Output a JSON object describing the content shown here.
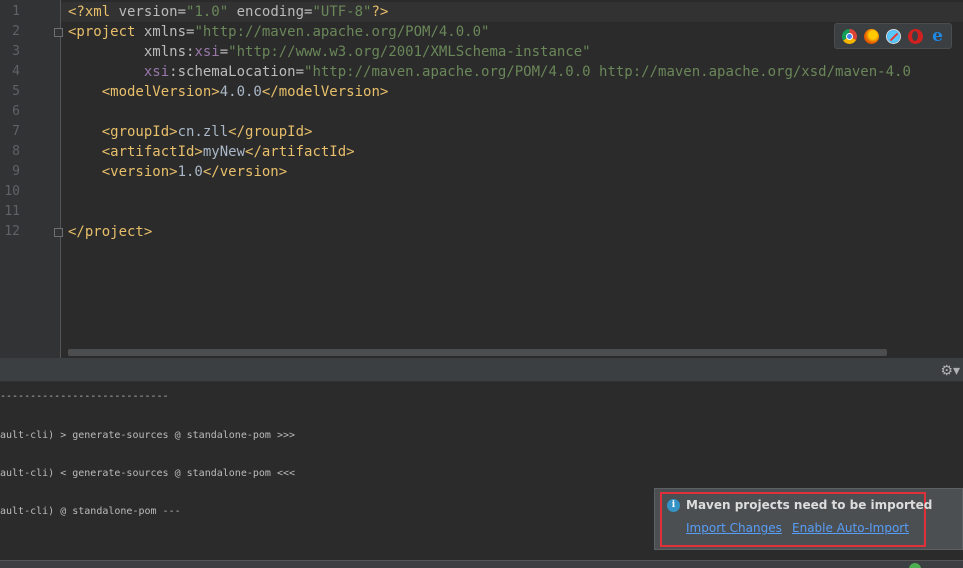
{
  "editor": {
    "line_numbers": [
      "1",
      "2",
      "3",
      "4",
      "5",
      "6",
      "7",
      "8",
      "9",
      "10",
      "11",
      "12"
    ],
    "lines": [
      [
        {
          "t": "<?xml ",
          "c": "t-pi"
        },
        {
          "t": "version=",
          "c": "t-attr"
        },
        {
          "t": "\"1.0\"",
          "c": "t-str"
        },
        {
          "t": " encoding=",
          "c": "t-attr"
        },
        {
          "t": "\"UTF-8\"",
          "c": "t-str"
        },
        {
          "t": "?>",
          "c": "t-pi"
        }
      ],
      [
        {
          "t": "<project ",
          "c": "t-tag"
        },
        {
          "t": "xmlns=",
          "c": "t-attr"
        },
        {
          "t": "\"http://maven.apache.org/POM/4.0.0\"",
          "c": "t-str"
        }
      ],
      [
        {
          "t": "         xmlns:",
          "c": "t-attr"
        },
        {
          "t": "xsi",
          "c": "t-ns"
        },
        {
          "t": "=",
          "c": "t-attr"
        },
        {
          "t": "\"http://www.w3.org/2001/XMLSchema-instance\"",
          "c": "t-str"
        }
      ],
      [
        {
          "t": "         ",
          "c": "t-attr"
        },
        {
          "t": "xsi",
          "c": "t-ns"
        },
        {
          "t": ":schemaLocation=",
          "c": "t-attr"
        },
        {
          "t": "\"http://maven.apache.org/POM/4.0.0 http://maven.apache.org/xsd/maven-4.0",
          "c": "t-str"
        }
      ],
      [
        {
          "t": "    <modelVersion>",
          "c": "t-tag"
        },
        {
          "t": "4.0.0",
          "c": "t-text"
        },
        {
          "t": "</modelVersion>",
          "c": "t-tag"
        }
      ],
      [],
      [
        {
          "t": "    <groupId>",
          "c": "t-tag"
        },
        {
          "t": "cn.zll",
          "c": "t-text"
        },
        {
          "t": "</groupId>",
          "c": "t-tag"
        }
      ],
      [
        {
          "t": "    <artifactId>",
          "c": "t-tag"
        },
        {
          "t": "myNew",
          "c": "t-text"
        },
        {
          "t": "</artifactId>",
          "c": "t-tag"
        }
      ],
      [
        {
          "t": "    <version>",
          "c": "t-tag"
        },
        {
          "t": "1.0",
          "c": "t-text"
        },
        {
          "t": "</version>",
          "c": "t-tag"
        }
      ],
      [],
      [],
      [
        {
          "t": "</project>",
          "c": "t-tag"
        }
      ]
    ],
    "browser_icons": [
      "chrome-icon",
      "firefox-icon",
      "safari-icon",
      "opera-icon",
      "ie-icon"
    ]
  },
  "panel": {
    "gear_glyph": "⚙▾"
  },
  "console": {
    "lines": [
      "----------------------------",
      "ault-cli) > generate-sources @ standalone-pom >>>",
      "ault-cli) < generate-sources @ standalone-pom <<<",
      "ault-cli) @ standalone-pom ---"
    ]
  },
  "notification": {
    "icon_glyph": "i",
    "title": "Maven projects need to be imported",
    "import_changes": "Import Changes",
    "enable_auto_import": "Enable Auto-Import"
  },
  "colors": {
    "background": "#2b2b2b",
    "tag": "#e8bf6a",
    "string": "#6a8759",
    "link": "#589df6",
    "highlight": "#e0313a"
  }
}
